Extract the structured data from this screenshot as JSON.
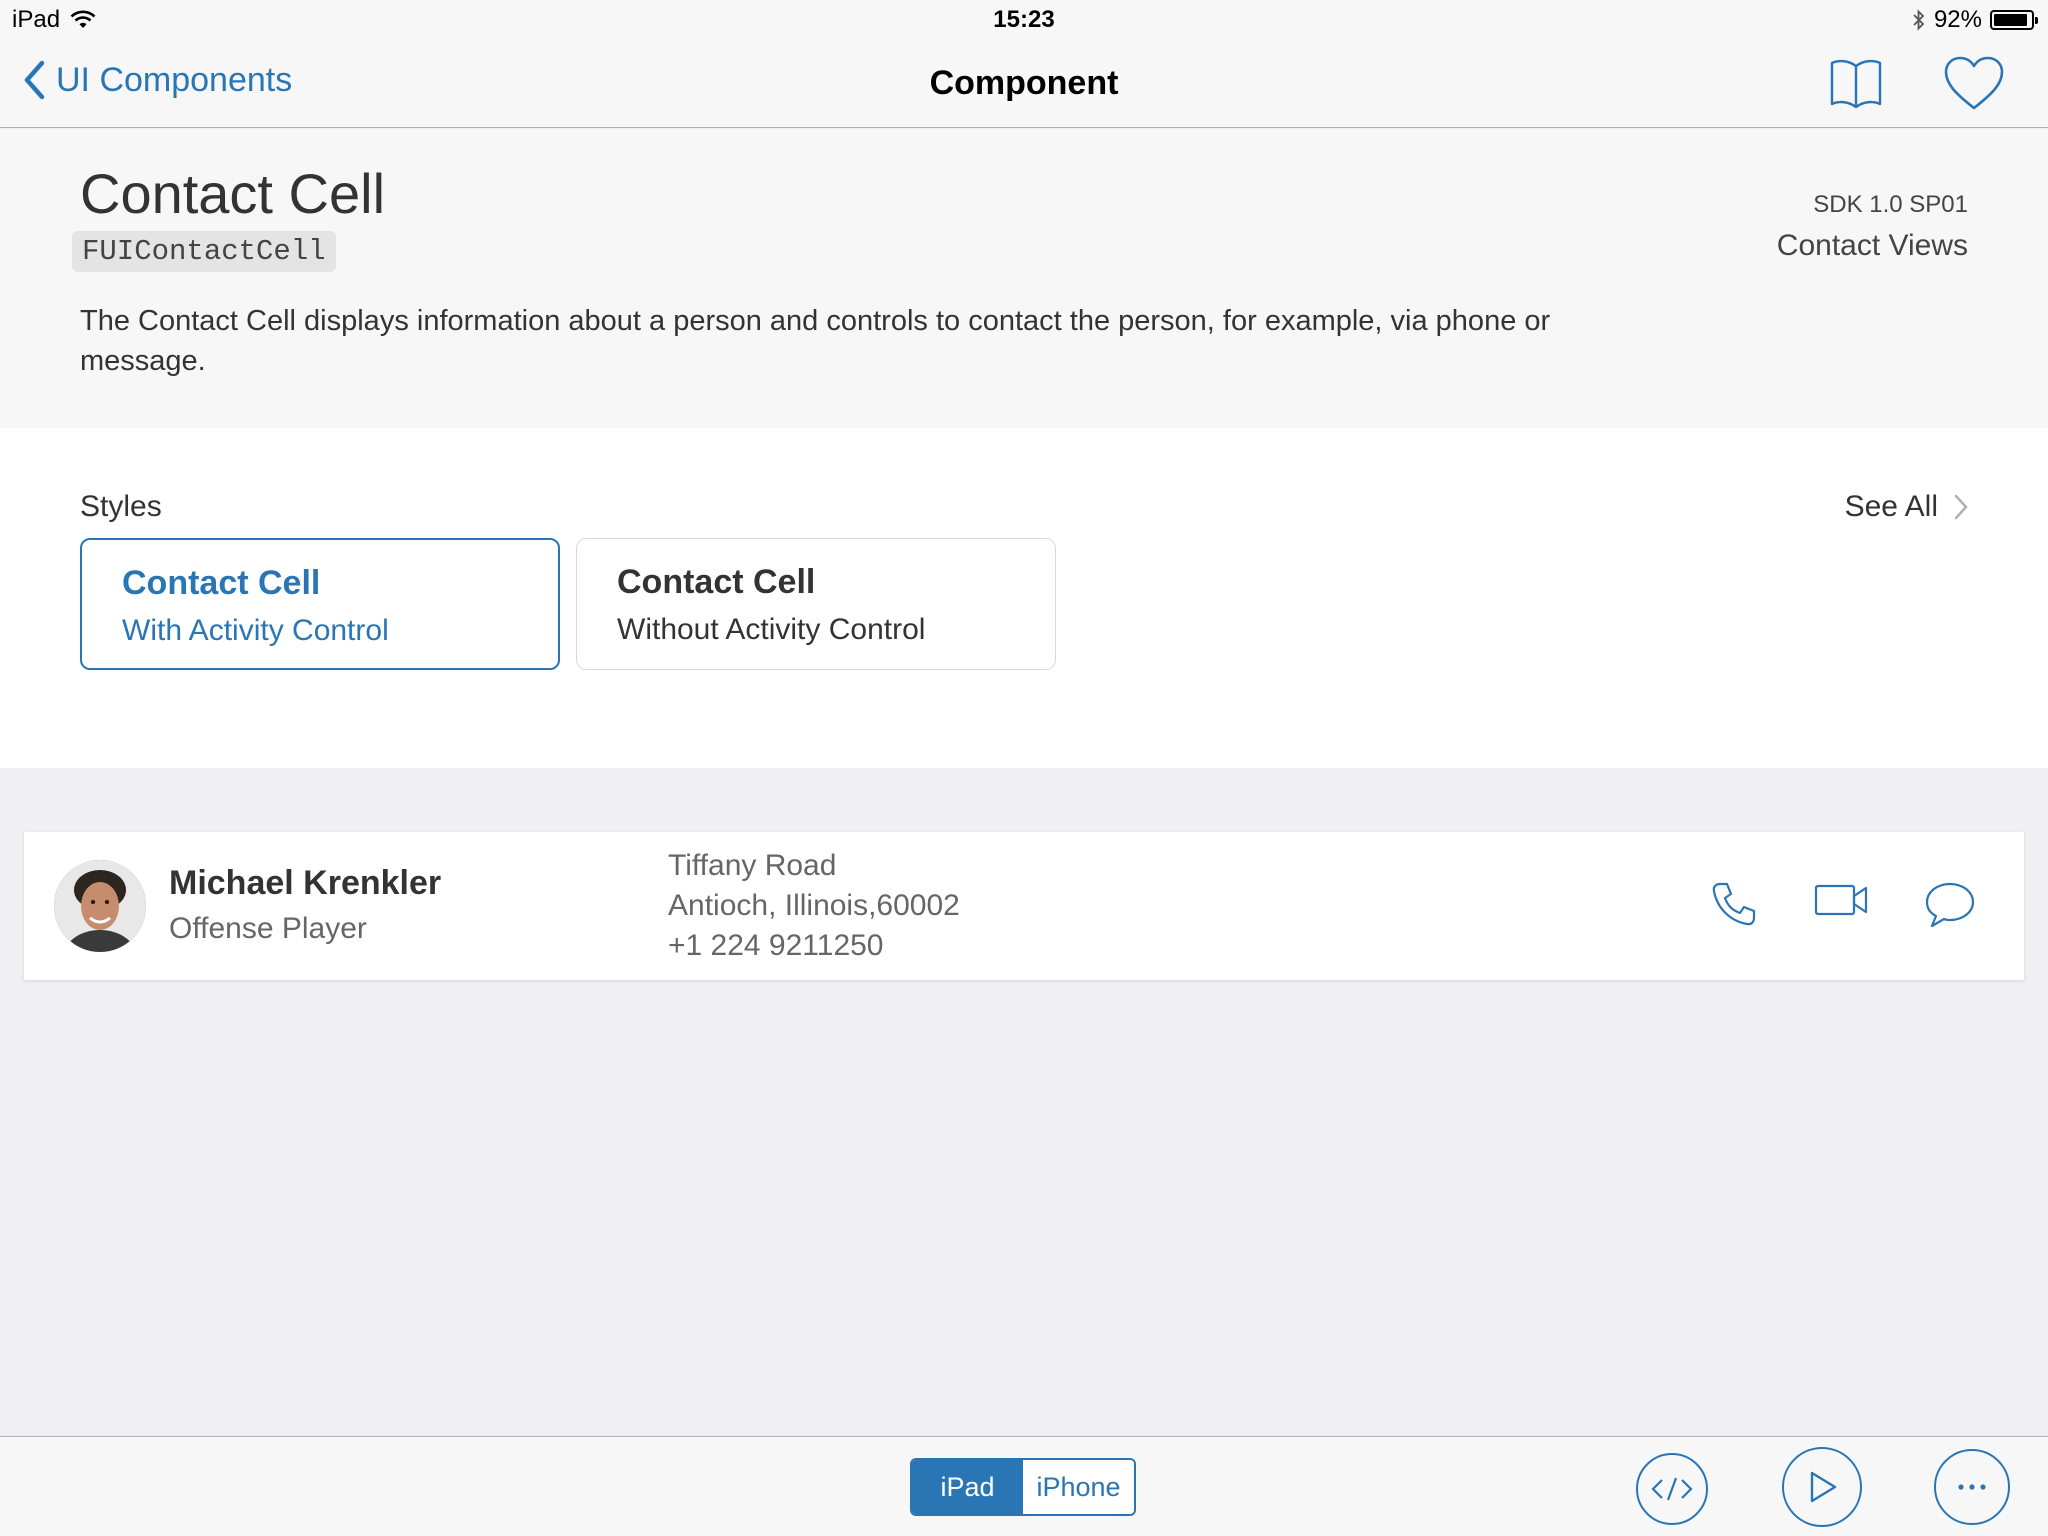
{
  "status_bar": {
    "device": "iPad",
    "time": "15:23",
    "battery": "92%",
    "battery_level": 0.92
  },
  "nav": {
    "back_label": "UI Components",
    "title": "Component"
  },
  "component": {
    "title": "Contact Cell",
    "class_name": "FUIContactCell",
    "sdk_version": "SDK 1.0 SP01",
    "category": "Contact Views",
    "description": "The Contact Cell displays information about a person and controls to contact the person, for example, via phone or message."
  },
  "styles": {
    "label": "Styles",
    "see_all": "See All",
    "cards": [
      {
        "title": "Contact Cell",
        "subtitle": "With Activity Control",
        "selected": true
      },
      {
        "title": "Contact Cell",
        "subtitle": "Without Activity Control",
        "selected": false
      }
    ]
  },
  "contact": {
    "name": "Michael Krenkler",
    "role": "Offense Player",
    "address_line1": "Tiffany Road",
    "address_line2": "Antioch, Illinois,60002",
    "phone": "+1 224 9211250",
    "actions": [
      "phone-icon",
      "video-icon",
      "message-icon"
    ]
  },
  "toolbar": {
    "segments": [
      "iPad",
      "iPhone"
    ],
    "active_segment": "iPad",
    "buttons": [
      "code-icon",
      "play-icon",
      "more-icon"
    ]
  },
  "colors": {
    "accent": "#2a75b3",
    "background": "#efeff4"
  }
}
